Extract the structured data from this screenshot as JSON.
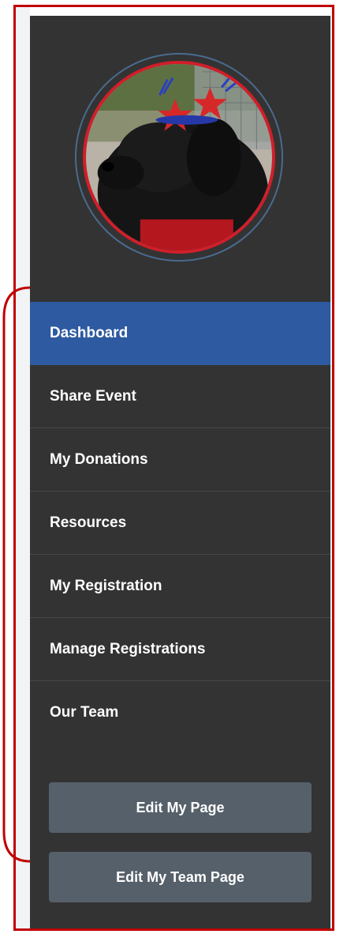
{
  "sidebar": {
    "avatar_alt": "black dog wearing star headband",
    "nav_items": [
      {
        "label": "Dashboard",
        "active": true
      },
      {
        "label": "Share Event"
      },
      {
        "label": "My Donations"
      },
      {
        "label": "Resources"
      },
      {
        "label": "My Registration"
      },
      {
        "label": "Manage Registrations"
      },
      {
        "label": "Our Team"
      }
    ],
    "buttons": {
      "edit_my_page": "Edit My Page",
      "edit_my_team_page": "Edit My Team Page"
    }
  },
  "colors": {
    "sidebar_bg": "#333333",
    "active_bg": "#2d5aa0",
    "button_bg": "#56606a",
    "frame": "#c00000"
  }
}
